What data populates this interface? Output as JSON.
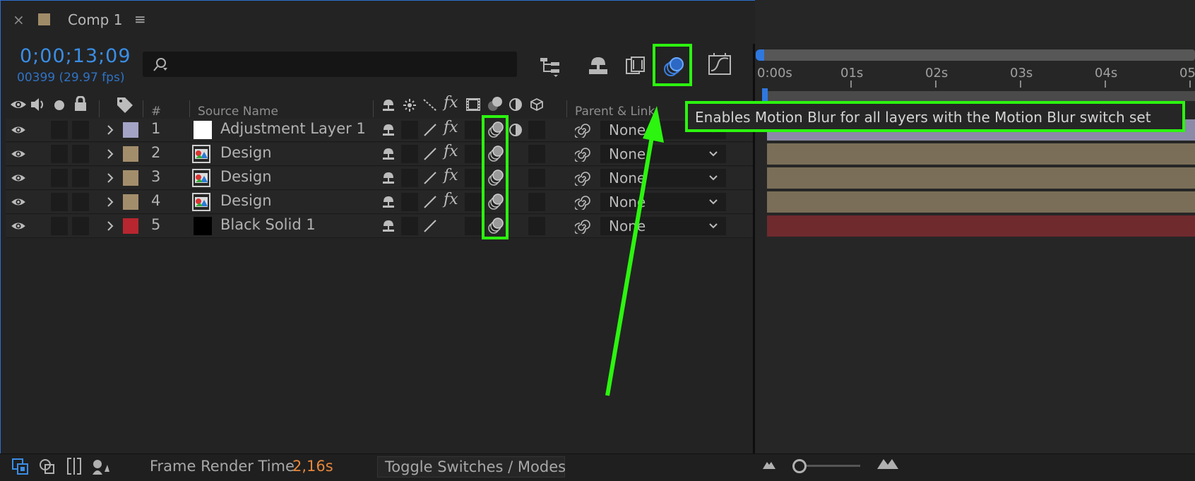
{
  "panel": {
    "close_glyph": "×",
    "title": "Comp 1",
    "menu_glyph": "≡",
    "swatch_color": "#a08b69"
  },
  "timecode": {
    "current": "0;00;13;09",
    "frames": "00399 (29.97 fps)"
  },
  "search": {
    "placeholder": "",
    "value": ""
  },
  "columns": {
    "number": "#",
    "source_name": "Source Name",
    "parent_link": "Parent & Link"
  },
  "layers": [
    {
      "num": "1",
      "name": "Adjustment Layer 1",
      "label_color": "#a3a3c6",
      "source": "white-solid",
      "fx": true,
      "adjust": true,
      "parent": "None"
    },
    {
      "num": "2",
      "name": "Design",
      "label_color": "#a38e6c",
      "source": "comp",
      "fx": true,
      "adjust": false,
      "parent": "None"
    },
    {
      "num": "3",
      "name": "Design",
      "label_color": "#a38e6c",
      "source": "comp",
      "fx": true,
      "adjust": false,
      "parent": "None"
    },
    {
      "num": "4",
      "name": "Design",
      "label_color": "#a38e6c",
      "source": "comp",
      "fx": true,
      "adjust": false,
      "parent": "None"
    },
    {
      "num": "5",
      "name": "Black Solid 1",
      "label_color": "#b8262f",
      "source": "black-solid",
      "fx": false,
      "adjust": false,
      "parent": "None"
    }
  ],
  "timeline": {
    "ticks": [
      "0:00s",
      "01s",
      "02s",
      "03s",
      "04s",
      "05"
    ],
    "track_colors": [
      "#8b8aa8",
      "#7a6e58",
      "#7a6e58",
      "#7a6e58",
      "#6f2a2e"
    ]
  },
  "tooltip": {
    "text": "Enables Motion Blur for all layers with the Motion Blur switch set"
  },
  "status": {
    "frame_render_label": "Frame Render Time",
    "frame_render_value": "2,16s",
    "toggle_label": "Toggle Switches / Modes"
  },
  "colors": {
    "accent_blue": "#3a8ee6",
    "highlight_green": "#2cf50f",
    "orange": "#e6873c"
  },
  "icons": [
    "close-icon",
    "hamburger-menu-icon",
    "search-icon",
    "flowchart-icon",
    "shy-layers-icon",
    "frame-blending-icon",
    "motion-blur-icon",
    "graph-editor-icon",
    "eye-icon",
    "audio-icon",
    "solo-icon",
    "lock-icon",
    "label-tag-icon",
    "shy-icon",
    "collapse-icon",
    "quality-icon",
    "fx-icon",
    "frame-blend-icon",
    "adjustment-icon",
    "3d-cube-icon",
    "pick-whip-icon",
    "chevron-down-icon",
    "expand-chevron-icon"
  ]
}
